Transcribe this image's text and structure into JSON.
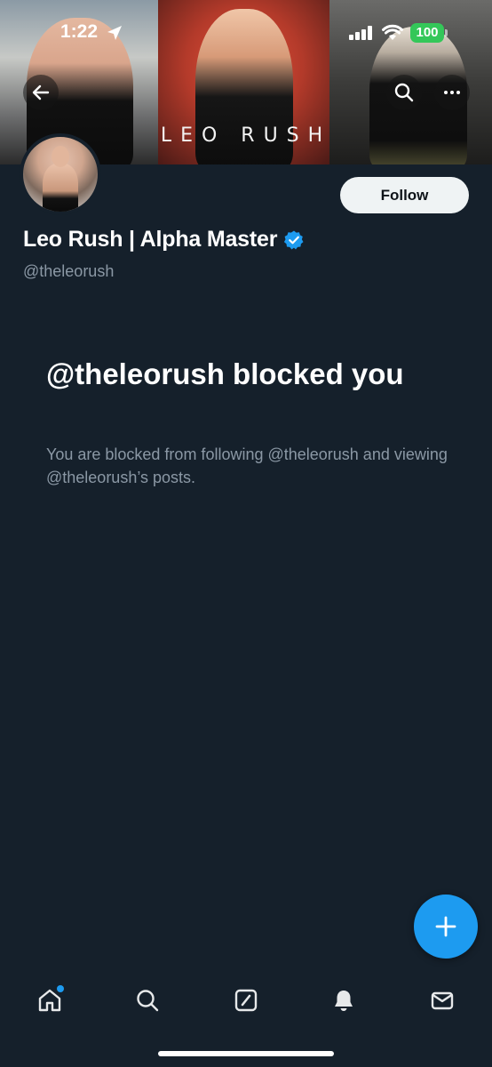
{
  "status_bar": {
    "time": "1:22",
    "battery": "100",
    "icons": [
      "location-arrow-icon",
      "signal-icon",
      "wifi-icon",
      "battery-icon"
    ]
  },
  "banner": {
    "logo_text": "LEO RUSH",
    "icons": [
      "back-arrow-icon",
      "search-icon",
      "more-icon"
    ]
  },
  "profile": {
    "display_name": "Leo Rush | Alpha Master",
    "handle": "@theleorush",
    "verified": true,
    "follow_label": "Follow"
  },
  "blocked": {
    "title": "@theleorush blocked you",
    "description": "You are blocked from following @theleorush and viewing @theleorush’s posts."
  },
  "fab": {
    "icon": "plus-icon"
  },
  "bottom_nav": {
    "items": [
      {
        "name": "home",
        "icon": "home-icon",
        "badge": true
      },
      {
        "name": "search",
        "icon": "search-icon"
      },
      {
        "name": "compose",
        "icon": "compose-icon"
      },
      {
        "name": "notifications",
        "icon": "bell-icon"
      },
      {
        "name": "messages",
        "icon": "mail-icon"
      }
    ]
  },
  "colors": {
    "background": "#15202b",
    "accent": "#1d9bf0",
    "secondary_text": "#8b98a5",
    "battery": "#34c759"
  }
}
